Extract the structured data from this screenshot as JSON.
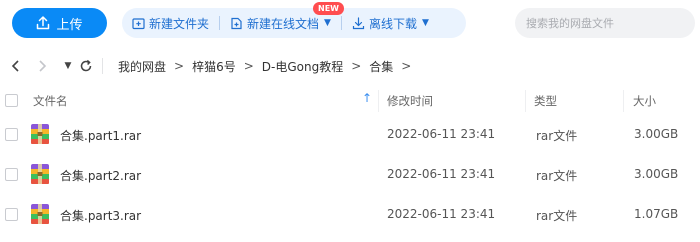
{
  "toolbar": {
    "upload_label": "上传",
    "new_folder_label": "新建文件夹",
    "new_online_doc_label": "新建在线文档",
    "new_badge": "NEW",
    "offline_download_label": "离线下载",
    "search_placeholder": "搜索我的网盘文件"
  },
  "breadcrumb": [
    "我的网盘",
    "梓猫6号",
    "D-电Gong教程",
    "合集"
  ],
  "breadcrumb_separator": ">",
  "columns": {
    "name": "文件名",
    "modified": "修改时间",
    "type": "类型",
    "size": "大小"
  },
  "files": [
    {
      "name": "合集.part1.rar",
      "modified": "2022-06-11 23:41",
      "type": "rar文件",
      "size": "3.00GB"
    },
    {
      "name": "合集.part2.rar",
      "modified": "2022-06-11 23:41",
      "type": "rar文件",
      "size": "3.00GB"
    },
    {
      "name": "合集.part3.rar",
      "modified": "2022-06-11 23:41",
      "type": "rar文件",
      "size": "1.07GB"
    }
  ],
  "colors": {
    "accent": "#0a8af6",
    "toolbar_group_bg": "#eaf3fe",
    "toolbar_group_text": "#1f6fd0",
    "new_badge": "#ff4d4f"
  },
  "icons": {
    "upload": "upload-icon",
    "new_folder": "new-folder-icon",
    "new_doc": "new-document-icon",
    "download": "download-icon",
    "back": "chevron-left-icon",
    "forward": "chevron-right-icon",
    "dropdown": "caret-down-icon",
    "refresh": "refresh-icon",
    "sort": "arrow-up-icon",
    "file": "rar-archive-icon"
  }
}
